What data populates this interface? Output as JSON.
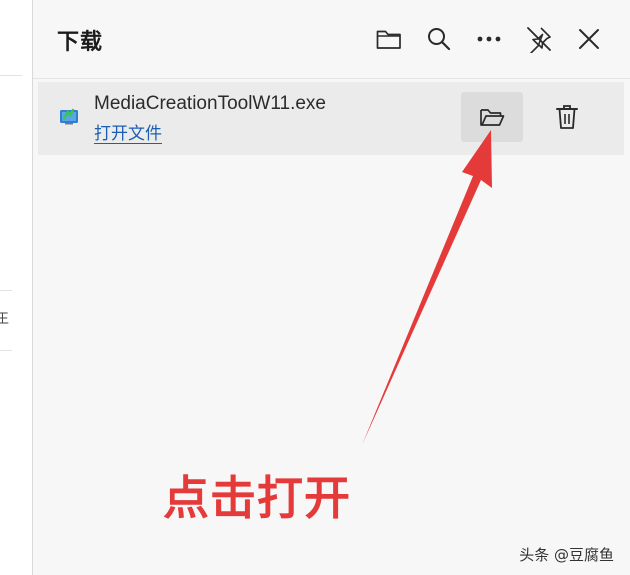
{
  "panel": {
    "title": "下载"
  },
  "header_icons": {
    "open_folder": "folder-icon",
    "search": "search-icon",
    "more": "more-options-icon",
    "pin": "pin-off-icon",
    "close": "close-icon"
  },
  "download_item": {
    "file_name": "MediaCreationToolW11.exe",
    "open_link_label": "打开文件",
    "file_icon": "installer-app-icon",
    "show_in_folder_icon": "open-folder-icon",
    "delete_icon": "trash-icon"
  },
  "annotation": {
    "caption": "点击打开",
    "color": "#e53a3a"
  },
  "watermark": {
    "text": "头条 @豆腐鱼"
  },
  "colors": {
    "link": "#1a5fb4",
    "panel_bg": "#f7f7f7",
    "row_bg": "#ebebeb",
    "hover_bg": "#dcdcdc"
  }
}
